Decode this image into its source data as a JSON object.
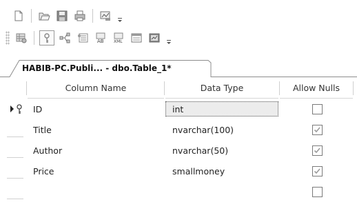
{
  "toolbar1": {
    "buttons": [
      "new-page-icon",
      "open-folder-icon",
      "save-disk-icon",
      "print-icon",
      "chart-icon"
    ]
  },
  "toolbar2": {
    "buttons": [
      "grid-set-key-icon",
      "primary-key-icon",
      "relationships-icon",
      "indexes-icon",
      "text-index-icon",
      "xml-index-icon",
      "check-constraint-icon",
      "spatial-index-icon"
    ]
  },
  "tab": {
    "title": "HABIB-PC.Publi... - dbo.Table_1*"
  },
  "grid": {
    "headers": {
      "column_name": "Column Name",
      "data_type": "Data Type",
      "allow_nulls": "Allow Nulls"
    },
    "rows": [
      {
        "name": "ID",
        "type": "int",
        "allow_nulls": false,
        "primary_key": true,
        "selected": true
      },
      {
        "name": "Title",
        "type": "nvarchar(100)",
        "allow_nulls": true
      },
      {
        "name": "Author",
        "type": "nvarchar(50)",
        "allow_nulls": true
      },
      {
        "name": "Price",
        "type": "smallmoney",
        "allow_nulls": true
      },
      {
        "name": "",
        "type": "",
        "allow_nulls": false
      }
    ]
  },
  "colors": {
    "selected_cell_bg": "#ececec",
    "checkbox_border": "#7a7a7a",
    "check_mark": "#9a9a9a"
  }
}
